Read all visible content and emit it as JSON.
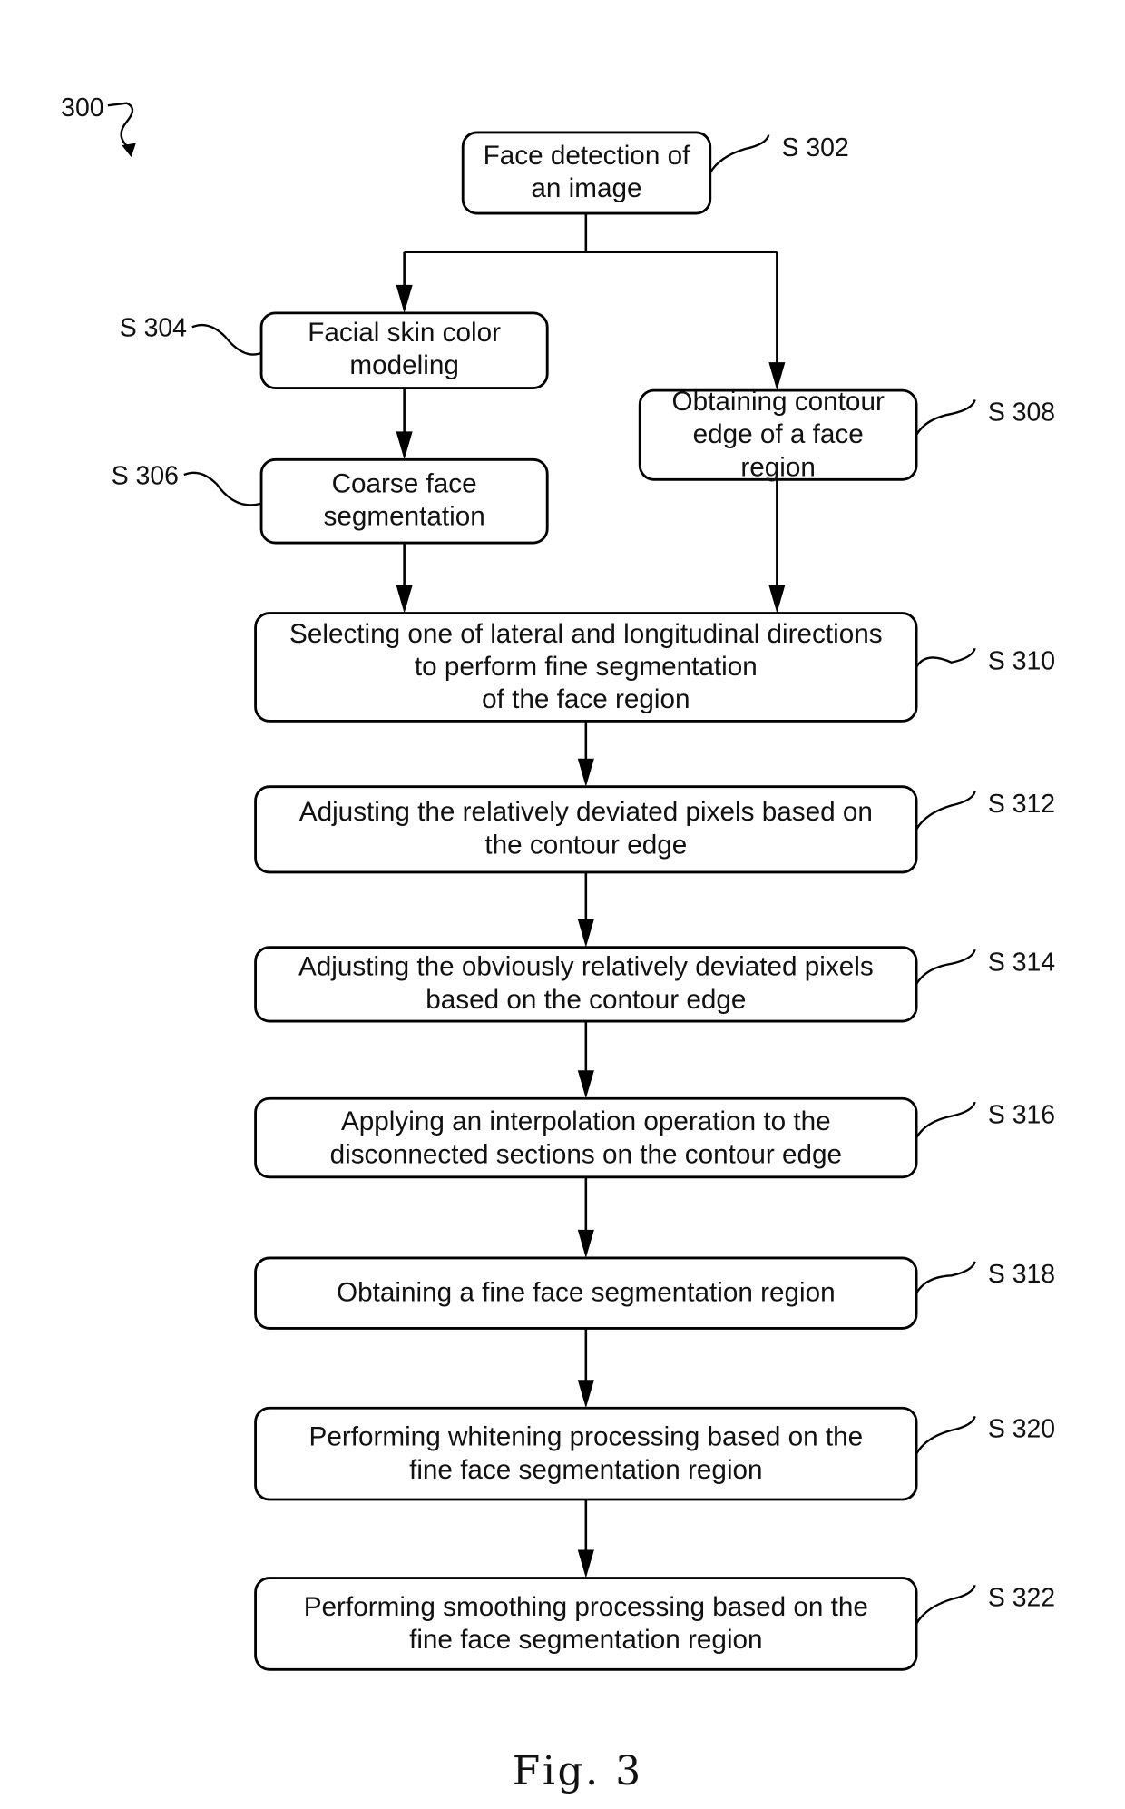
{
  "figure": {
    "ref": "300",
    "caption": "Fig. 3"
  },
  "steps": [
    {
      "id": "S302",
      "label": "S 302",
      "lines": [
        "Face detection of",
        "an image"
      ]
    },
    {
      "id": "S304",
      "label": "S 304",
      "lines": [
        "Facial skin color",
        "modeling"
      ]
    },
    {
      "id": "S306",
      "label": "S 306",
      "lines": [
        "Coarse face",
        "segmentation"
      ]
    },
    {
      "id": "S308",
      "label": "S 308",
      "lines": [
        "Obtaining contour",
        "edge of a face",
        "region"
      ]
    },
    {
      "id": "S310",
      "label": "S 310",
      "lines": [
        "Selecting one of lateral and longitudinal directions",
        "to perform fine segmentation",
        "of the face region"
      ]
    },
    {
      "id": "S312",
      "label": "S 312",
      "lines": [
        "Adjusting the relatively deviated pixels based on",
        "the contour edge"
      ]
    },
    {
      "id": "S314",
      "label": "S 314",
      "lines": [
        "Adjusting the obviously relatively deviated pixels",
        "based on the contour edge"
      ]
    },
    {
      "id": "S316",
      "label": "S 316",
      "lines": [
        "Applying an interpolation operation to the",
        "disconnected sections on the contour edge"
      ]
    },
    {
      "id": "S318",
      "label": "S 318",
      "lines": [
        "Obtaining a fine face segmentation region"
      ]
    },
    {
      "id": "S320",
      "label": "S 320",
      "lines": [
        "Performing whitening processing based on the",
        "fine face segmentation region"
      ]
    },
    {
      "id": "S322",
      "label": "S 322",
      "lines": [
        "Performing smoothing processing based on the",
        "fine face segmentation region"
      ]
    }
  ],
  "edges": [
    [
      "S302",
      "S304"
    ],
    [
      "S302",
      "S308"
    ],
    [
      "S304",
      "S306"
    ],
    [
      "S306",
      "S310"
    ],
    [
      "S308",
      "S310"
    ],
    [
      "S310",
      "S312"
    ],
    [
      "S312",
      "S314"
    ],
    [
      "S314",
      "S316"
    ],
    [
      "S316",
      "S318"
    ],
    [
      "S318",
      "S320"
    ],
    [
      "S320",
      "S322"
    ]
  ]
}
